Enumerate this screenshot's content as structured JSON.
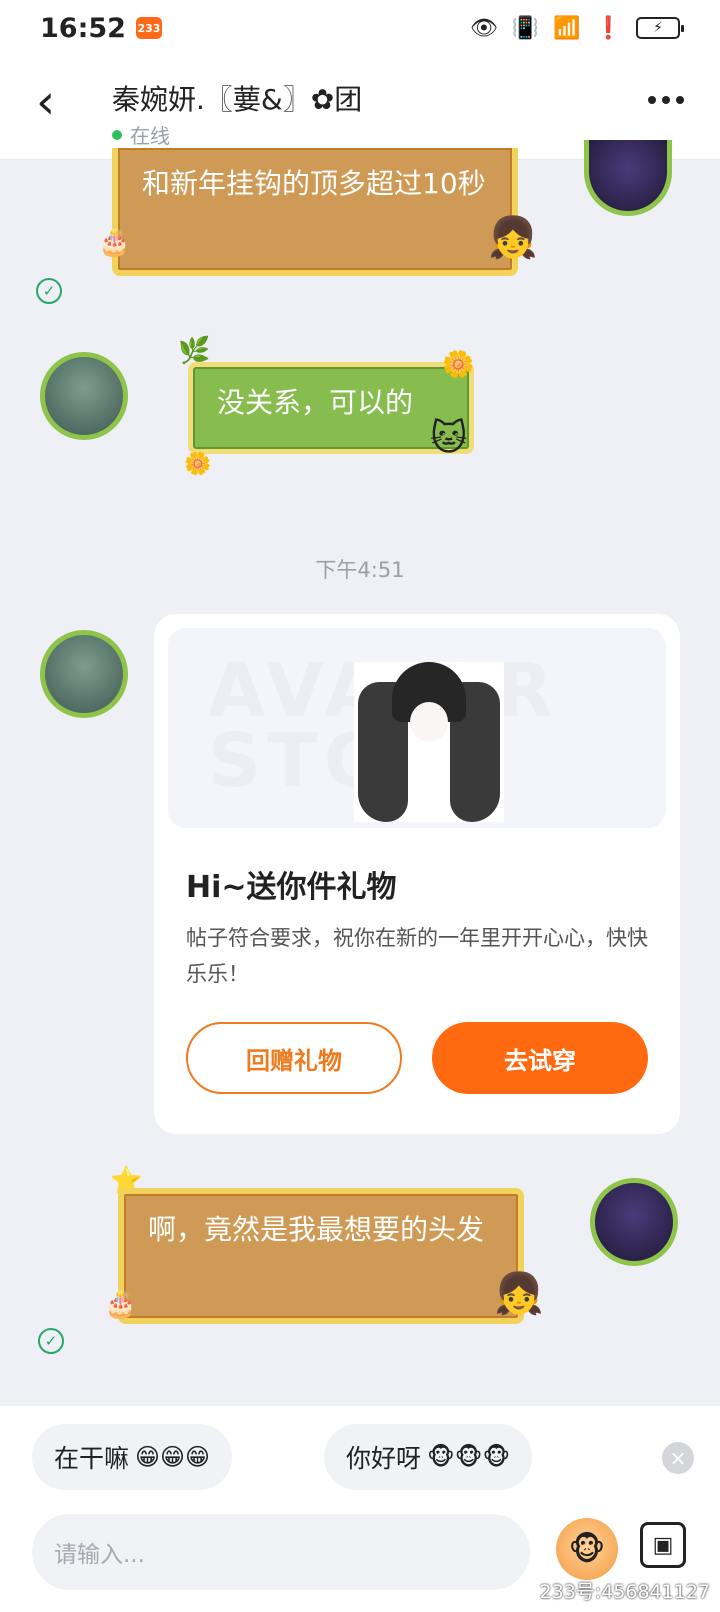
{
  "statusbar": {
    "time": "16:52",
    "app_badge": "233",
    "icons": [
      "eye-icon",
      "vibrate-icon",
      "wifi-icon",
      "alert-icon",
      "battery-charging-icon"
    ]
  },
  "header": {
    "contact_name": "秦婉妍.〖葽&〗✿团",
    "online_status": "在线"
  },
  "messages": {
    "sent_1": "和新年挂钩的顶多超过10秒",
    "received_1": "没关系，可以的",
    "time_divider": "下午4:51",
    "gift": {
      "banner_text": "AVATAR STORE",
      "title": "Hi~送你件礼物",
      "description": "帖子符合要求，祝你在新的一年里开开心心，快快乐乐！",
      "return_gift_label": "回赠礼物",
      "try_on_label": "去试穿"
    },
    "sent_2": "啊，竟然是我最想要的头发"
  },
  "quick_replies": [
    {
      "text": "在干嘛",
      "emoji": "😁😁😁"
    },
    {
      "text": "你好呀",
      "emoji": "🐵🐵🐵"
    }
  ],
  "composer": {
    "placeholder": "请输入..."
  },
  "watermark": "233号:456841127",
  "colors": {
    "accent_orange": "#ff6a10",
    "online_green": "#2fc05d",
    "bubble_gold": "#cf9a55",
    "bubble_green": "#86bd4e"
  }
}
